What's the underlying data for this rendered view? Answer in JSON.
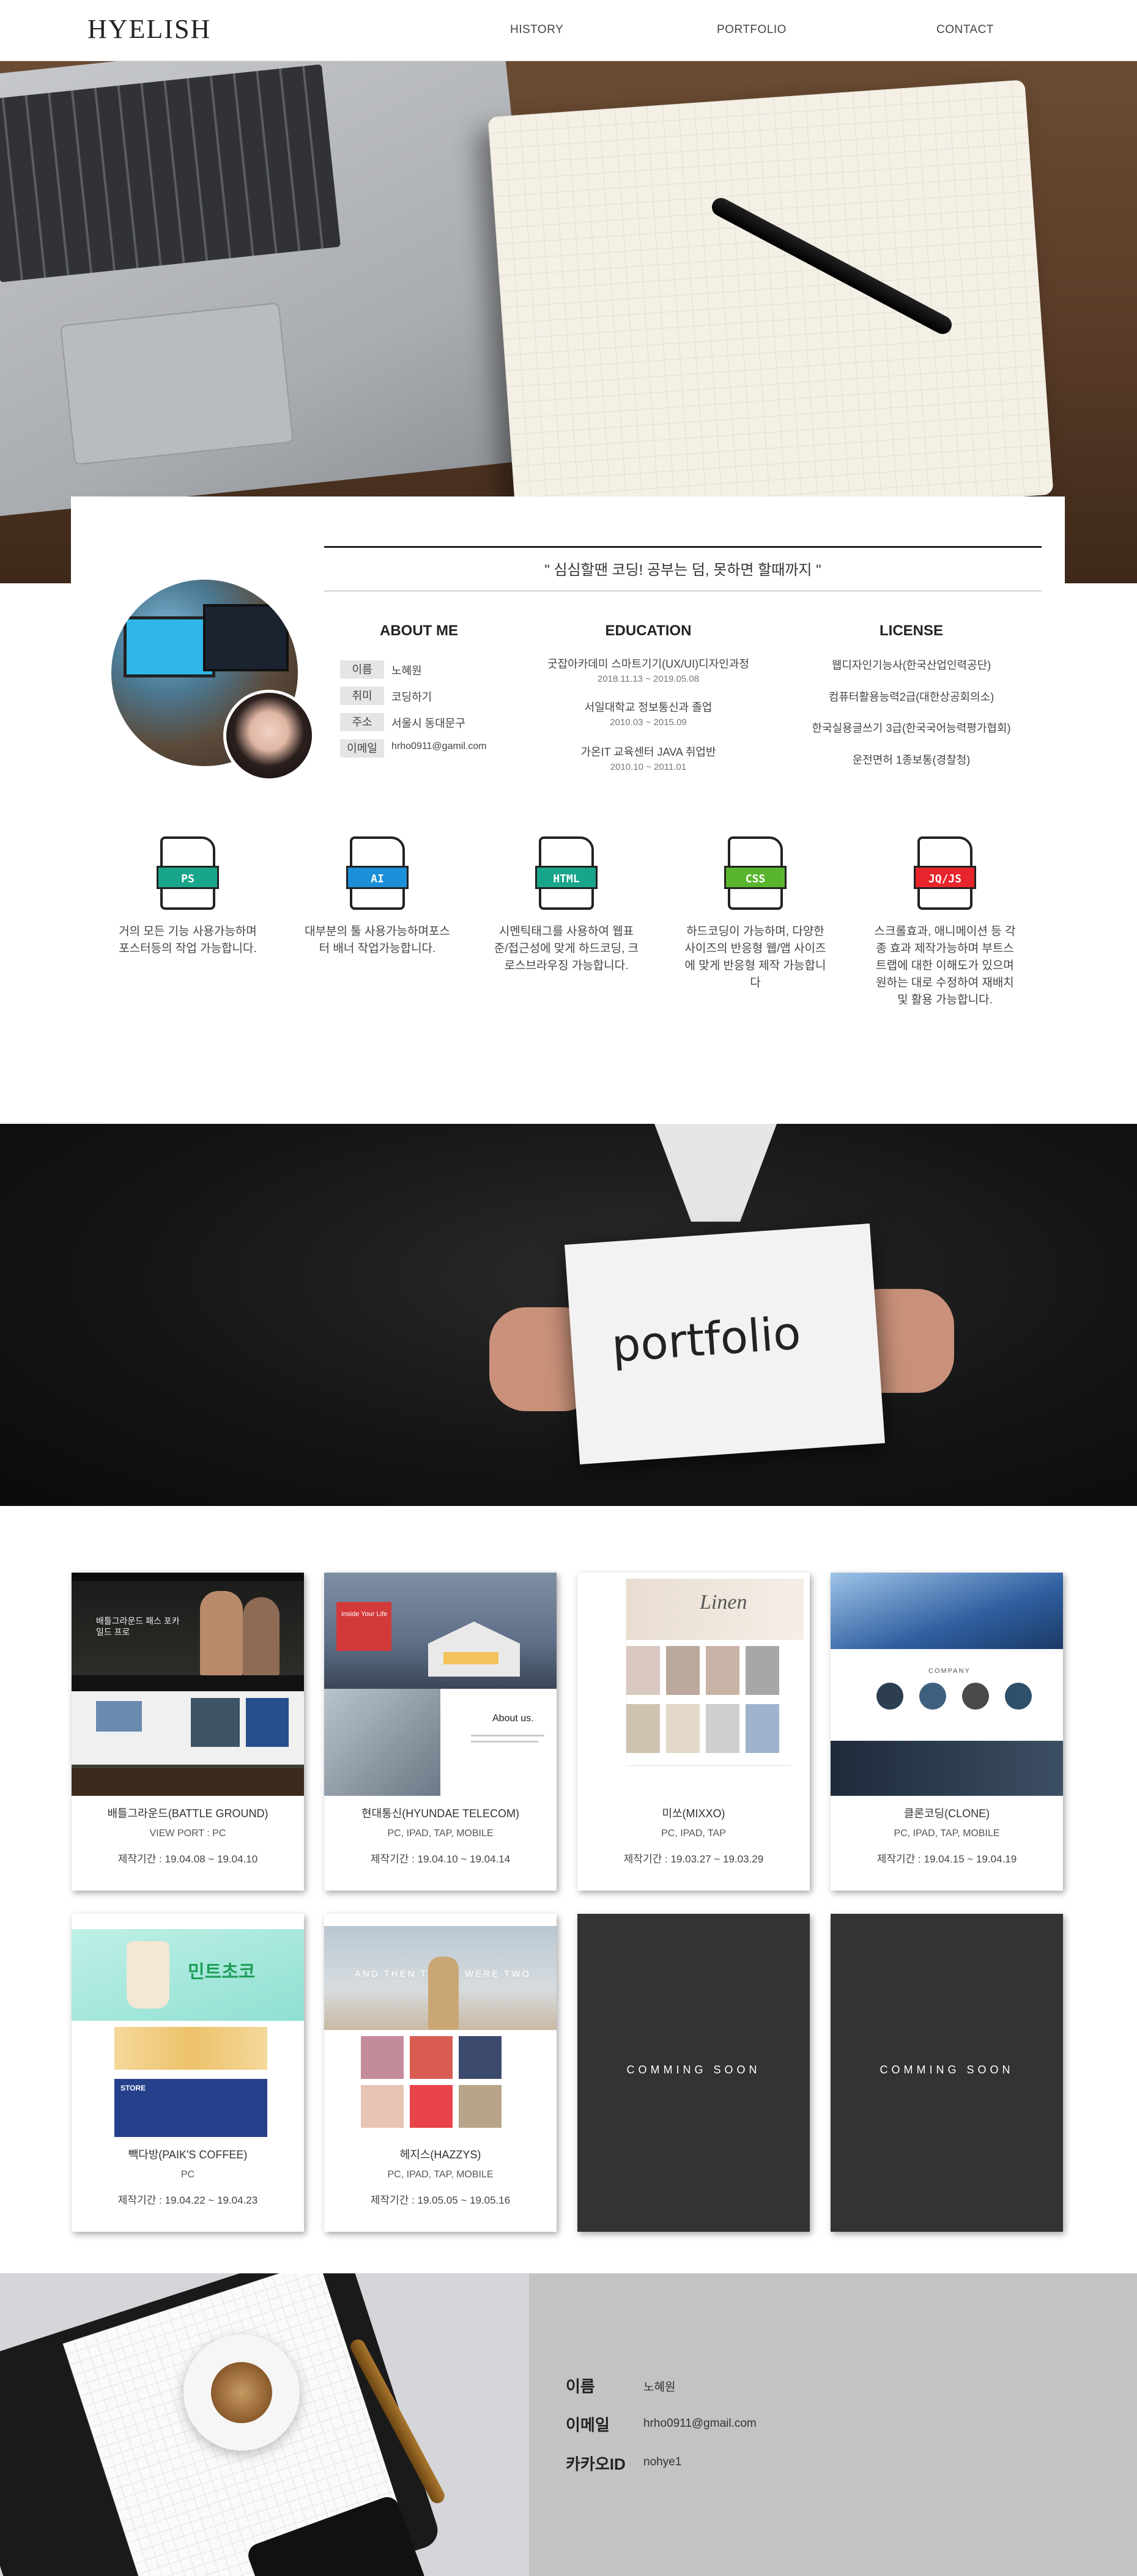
{
  "nav": {
    "logo": "HYELISH",
    "items": [
      "HISTORY",
      "PORTFOLIO",
      "CONTACT"
    ]
  },
  "quote": "\" 심심할땐 코딩! 공부는 덤, 못하면 할때까지 \"",
  "about": {
    "title": "ABOUT ME",
    "rows": [
      {
        "key": "이름",
        "value": "노혜원"
      },
      {
        "key": "취미",
        "value": "코딩하기"
      },
      {
        "key": "주소",
        "value": "서울시 동대문구"
      },
      {
        "key": "이메일",
        "value": "hrho0911@gamil.com"
      }
    ]
  },
  "education": {
    "title": "EDUCATION",
    "items": [
      {
        "name": "굿잡아카데미 스마트기기(UX/UI)디자인과정",
        "date": "2018.11.13 ~ 2019.05.08"
      },
      {
        "name": "서일대학교 정보통신과 졸업",
        "date": "2010.03 ~ 2015.09"
      },
      {
        "name": "가온IT 교육센터 JAVA 취업반",
        "date": "2010.10 ~ 2011.01"
      }
    ]
  },
  "license": {
    "title": "LICENSE",
    "items": [
      "웹디자인기능사(한국산업인력공단)",
      "컴퓨터활용능력2급(대한상공회의소)",
      "한국실용글쓰기 3급(한국국어능력평가협회)",
      "운전면허 1종보통(경찰청)"
    ]
  },
  "skills": [
    {
      "tag": "PS",
      "color": "#19a58a",
      "desc": "거의 모든 기능 사용가능하며 포스터등의 작업 가능합니다."
    },
    {
      "tag": "AI",
      "color": "#1b8fd8",
      "desc": "대부분의 툴 사용가능하며포스터 배너 작업가능합니다."
    },
    {
      "tag": "HTML",
      "color": "#19a58a",
      "desc": "시멘틱태그를 사용하여 웹표준/접근성에 맞게 하드코딩, 크로스브라우징 가능합니다."
    },
    {
      "tag": "CSS",
      "color": "#5ab52e",
      "desc": "하드코딩이 가능하며, 다양한 사이즈의 반응형 웹/앱 사이즈에 맞게 반응형 제작 가능합니다"
    },
    {
      "tag": "JQ/JS",
      "color": "#e8242c",
      "desc": "스크롤효과, 애니메이션 등 각종 효과 제작가능하며 부트스트랩에 대한 이해도가 있으며 원하는 대로 수정하여 재배치 및 활용 가능합니다."
    }
  ],
  "banner": {
    "text": "portfolio"
  },
  "portfolio": [
    {
      "name": "배틀그라운드(BATTLE GROUND)",
      "device": "VIEW PORT : PC",
      "period": "제작기간 : 19.04.08 ~ 19.04.10",
      "thumb": "battleground"
    },
    {
      "name": "현대통신(HYUNDAE TELECOM)",
      "device": "PC, IPAD, TAP, MOBILE",
      "period": "제작기간 : 19.04.10 ~ 19.04.14",
      "thumb": "hyundae"
    },
    {
      "name": "미쏘(MIXXO)",
      "device": "PC, IPAD, TAP",
      "period": "제작기간 : 19.03.27 ~ 19.03.29",
      "thumb": "mixxo"
    },
    {
      "name": "클론코딩(CLONE)",
      "device": "PC, IPAD, TAP, MOBILE",
      "period": "제작기간 : 19.04.15 ~ 19.04.19",
      "thumb": "clone"
    },
    {
      "name": "빽다방(PAIK'S COFFEE)",
      "device": "PC",
      "period": "제작기간 : 19.04.22 ~ 19.04.23",
      "thumb": "paiks"
    },
    {
      "name": "헤지스(HAZZYS)",
      "device": "PC, IPAD, TAP, MOBILE",
      "period": "제작기간 : 19.05.05 ~ 19.05.16",
      "thumb": "hazzys"
    }
  ],
  "coming_soon": [
    "COMMING SOON",
    "COMMING SOON"
  ],
  "thumb_text": {
    "battleground": "배틀그라운드 패스 포카일드 프로",
    "hyundae_hero": "Inside Your Life",
    "hyundae_about": "About us.",
    "mixxo": "Linen",
    "clone": "COMPANY",
    "paiks": "민트초코",
    "paiks_store": "STORE",
    "hazzys": "AND THEN THERE WERE TWO"
  },
  "contact": {
    "rows": [
      {
        "key": "이름",
        "value": "노혜원"
      },
      {
        "key": "이메일",
        "value": "hrho0911@gmail.com"
      },
      {
        "key": "카카오ID",
        "value": "nohye1"
      }
    ]
  }
}
